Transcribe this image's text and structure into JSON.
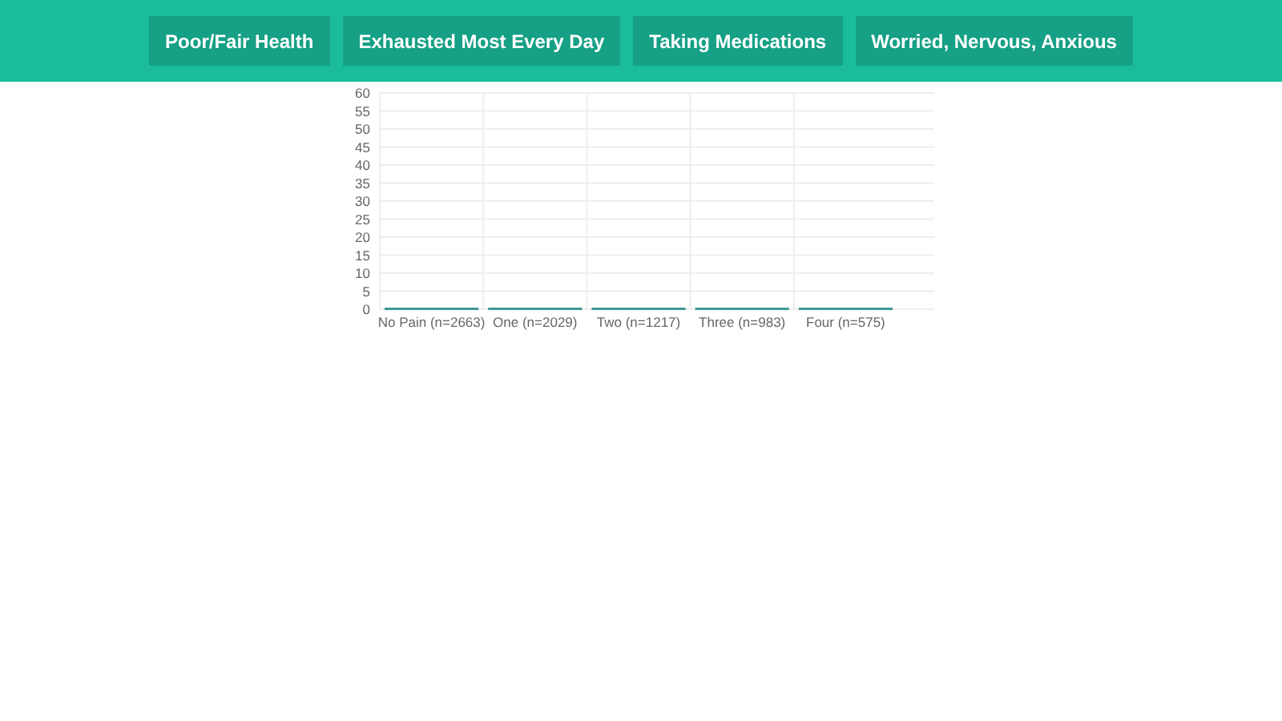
{
  "nav": {
    "buttons": [
      "Poor/Fair Health",
      "Exhausted Most Every Day",
      "Taking Medications",
      "Worried, Nervous, Anxious"
    ]
  },
  "chart": {
    "chart_data": {
      "type": "bar",
      "grid": true,
      "categories": [
        "No Pain (n=2663)",
        "One (n=2029)",
        "Two (n=1217)",
        "Three (n=983)",
        "Four (n=575)"
      ],
      "values": [
        0,
        0,
        0,
        0,
        0
      ],
      "ylim": [
        0,
        60
      ],
      "yticks": [
        0,
        5,
        10,
        15,
        20,
        25,
        30,
        35,
        40,
        45,
        50,
        55,
        60
      ]
    }
  }
}
